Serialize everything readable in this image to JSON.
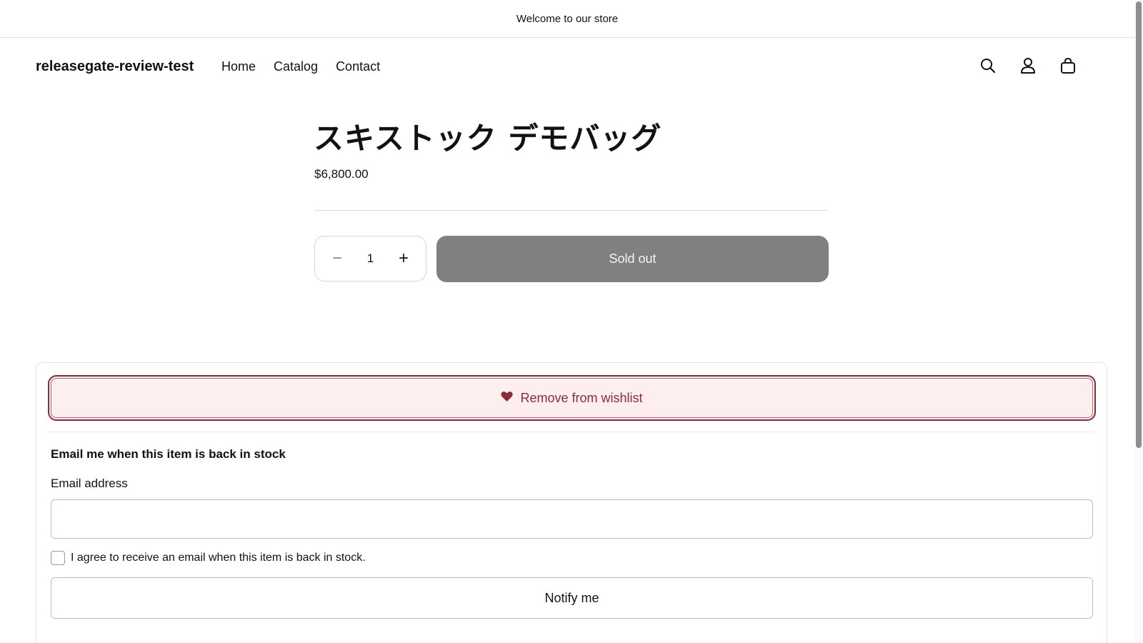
{
  "announcement": {
    "text": "Welcome to our store"
  },
  "header": {
    "logo": "releasegate-review-test",
    "nav": [
      "Home",
      "Catalog",
      "Contact"
    ],
    "icons": [
      "search-icon",
      "account-icon",
      "cart-icon"
    ]
  },
  "product": {
    "title": "スキストック デモバッグ",
    "price": "$6,800.00",
    "quantity": "1",
    "qty_minus": "−",
    "qty_plus": "+",
    "sold_out_label": "Sold out"
  },
  "wishlist": {
    "label": "Remove from wishlist",
    "icon": "heart-icon",
    "color": "#8b2c3b"
  },
  "back_in_stock": {
    "heading": "Email me when this item is back in stock",
    "email_label": "Email address",
    "email_value": "",
    "agree_text": "I agree to receive an email when this item is back in stock.",
    "agree_checked": false,
    "notify_label": "Notify me"
  },
  "colors": {
    "sold_out_bg": "#808080",
    "wishlist_bg": "#fdeff0"
  }
}
